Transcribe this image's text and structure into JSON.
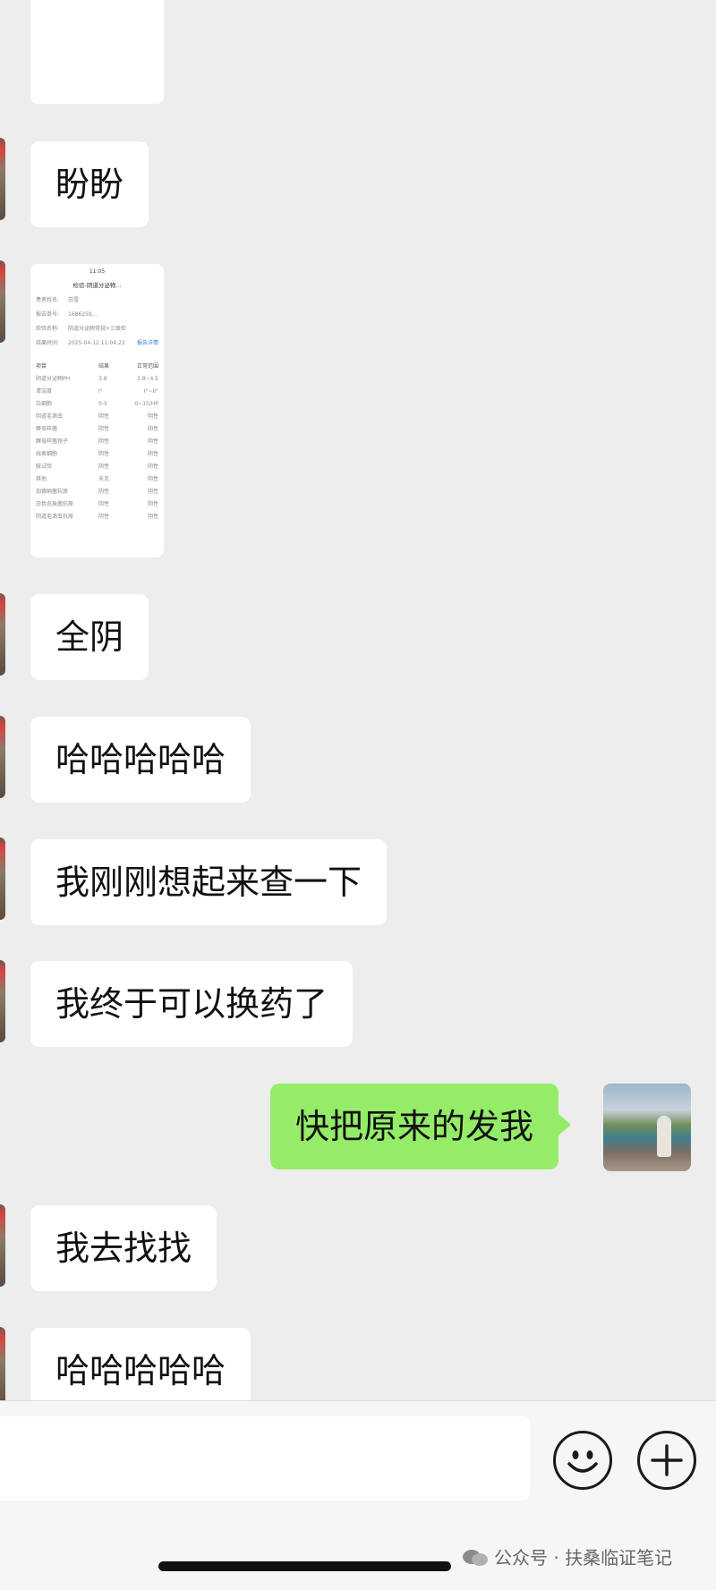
{
  "messages": [
    {
      "side": "left",
      "text": "盼盼"
    },
    {
      "side": "left",
      "text": "全阴"
    },
    {
      "side": "left",
      "text": "哈哈哈哈哈"
    },
    {
      "side": "left",
      "text": "我刚刚想起来查一下"
    },
    {
      "side": "left",
      "text": "我终于可以换药了"
    },
    {
      "side": "right",
      "text": "快把原来的发我"
    },
    {
      "side": "left",
      "text": "我去找找"
    },
    {
      "side": "left",
      "text": "哈哈哈哈哈"
    }
  ],
  "report_thumbnail": {
    "status_time": "11:05",
    "title": "检验-阴道分泌物...",
    "fields": [
      {
        "label": "患者姓名:",
        "value": "白雪"
      },
      {
        "label": "报告单号:",
        "value": "1686259..."
      },
      {
        "label": "检验名称:",
        "value": "阴道分泌物常规+三联检"
      },
      {
        "label": "结果时间:",
        "value": "2025-04-12 11:04:22",
        "link": "报告详情"
      }
    ],
    "table_header": [
      "项目",
      "结果",
      "正常范围"
    ],
    "rows": [
      [
        "阴道分泌物PH",
        "3.8",
        "3.8~4.5"
      ],
      [
        "清洁度",
        "I°",
        "I°~II°"
      ],
      [
        "白细胞",
        "0-5",
        "0~15/HP"
      ],
      [
        "阴道毛滴虫",
        "阴性",
        "阴性"
      ],
      [
        "酵母样菌",
        "阴性",
        "阴性"
      ],
      [
        "酵母样菌孢子",
        "阴性",
        "阴性"
      ],
      [
        "线索细胞",
        "阴性",
        "阴性"
      ],
      [
        "胺试验",
        "阴性",
        "阴性"
      ],
      [
        "其他",
        "未见",
        "阴性"
      ],
      [
        "加德纳菌抗原",
        "阴性",
        "阴性"
      ],
      [
        "白色念珠菌抗原",
        "阴性",
        "阴性"
      ],
      [
        "阴道毛滴虫抗原",
        "阴性",
        "阴性"
      ]
    ]
  },
  "watermark": "公众号 · 扶桑临证笔记",
  "colors": {
    "background": "#ededed",
    "received_bubble": "#ffffff",
    "sent_bubble": "#95ec69"
  }
}
